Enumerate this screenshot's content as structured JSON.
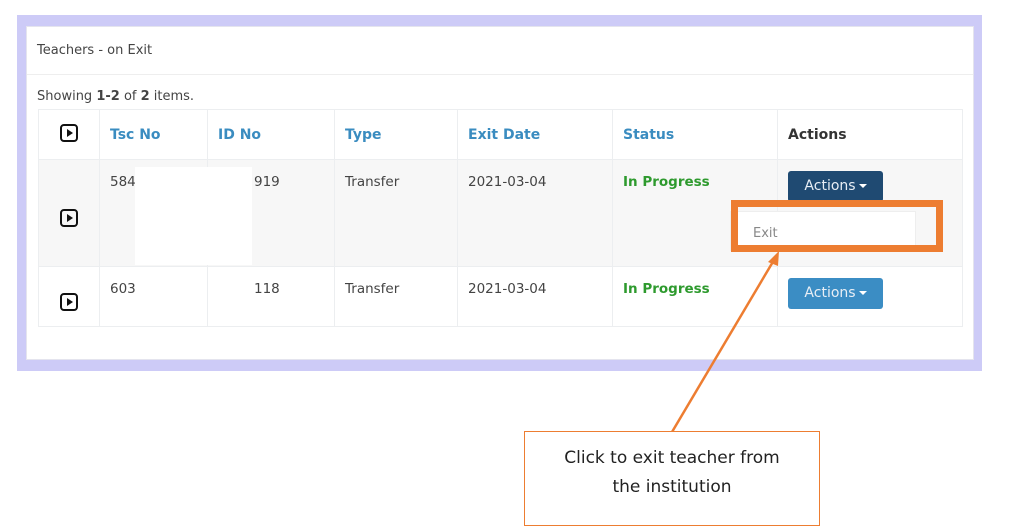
{
  "panel": {
    "title": "Teachers - on Exit",
    "summary": {
      "prefix": "Showing ",
      "range": "1-2",
      "mid": " of ",
      "total": "2",
      "suffix": " items."
    }
  },
  "table": {
    "headers": [
      "Tsc No",
      "ID No",
      "Type",
      "Exit Date",
      "Status",
      "Actions"
    ],
    "rows": [
      {
        "tsc_no": "584",
        "id_no": "919",
        "type": "Transfer",
        "exit_date": "2021-03-04",
        "status": "In Progress",
        "action_label": "Actions"
      },
      {
        "tsc_no": "603",
        "id_no": "118",
        "type": "Transfer",
        "exit_date": "2021-03-04",
        "status": "In Progress",
        "action_label": "Actions"
      }
    ]
  },
  "dropdown": {
    "items": [
      "Exit"
    ]
  },
  "callout": {
    "line1": "Click to exit teacher from",
    "line2": "the institution"
  },
  "colors": {
    "frame": "#cdcbf7",
    "header_link": "#3a8cc0",
    "status": "#2e9a2e",
    "button_active": "#1f4a72",
    "button": "#3b8dc4",
    "annotation": "#ed7d31"
  },
  "icons": {
    "row_expand": "play-square-icon",
    "caret": "caret-down-icon"
  }
}
